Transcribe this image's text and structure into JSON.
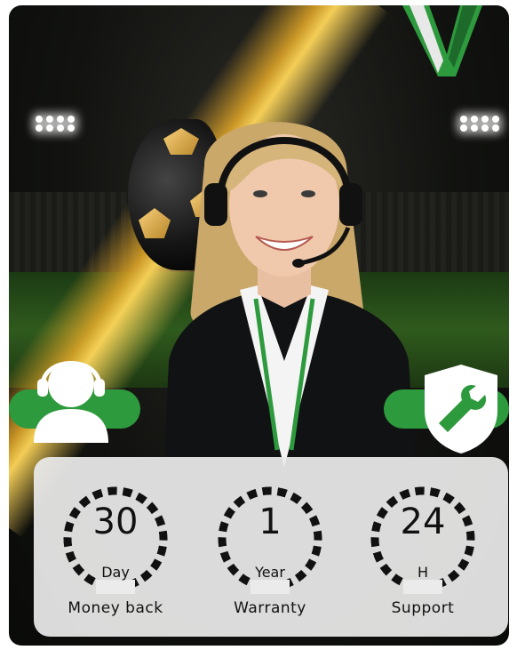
{
  "stats": [
    {
      "value": "30",
      "unit": "Day",
      "label": "Money back"
    },
    {
      "value": "1",
      "unit": "Year",
      "label": "Warranty"
    },
    {
      "value": "24",
      "unit": "H",
      "label": "Support"
    }
  ],
  "colors": {
    "accent_green": "#2e9a3e",
    "gold": "#e0a93a",
    "panel": "#ebebeb"
  },
  "icons": [
    "support-agent-icon",
    "wrench-shield-icon",
    "brand-logo-icon"
  ]
}
